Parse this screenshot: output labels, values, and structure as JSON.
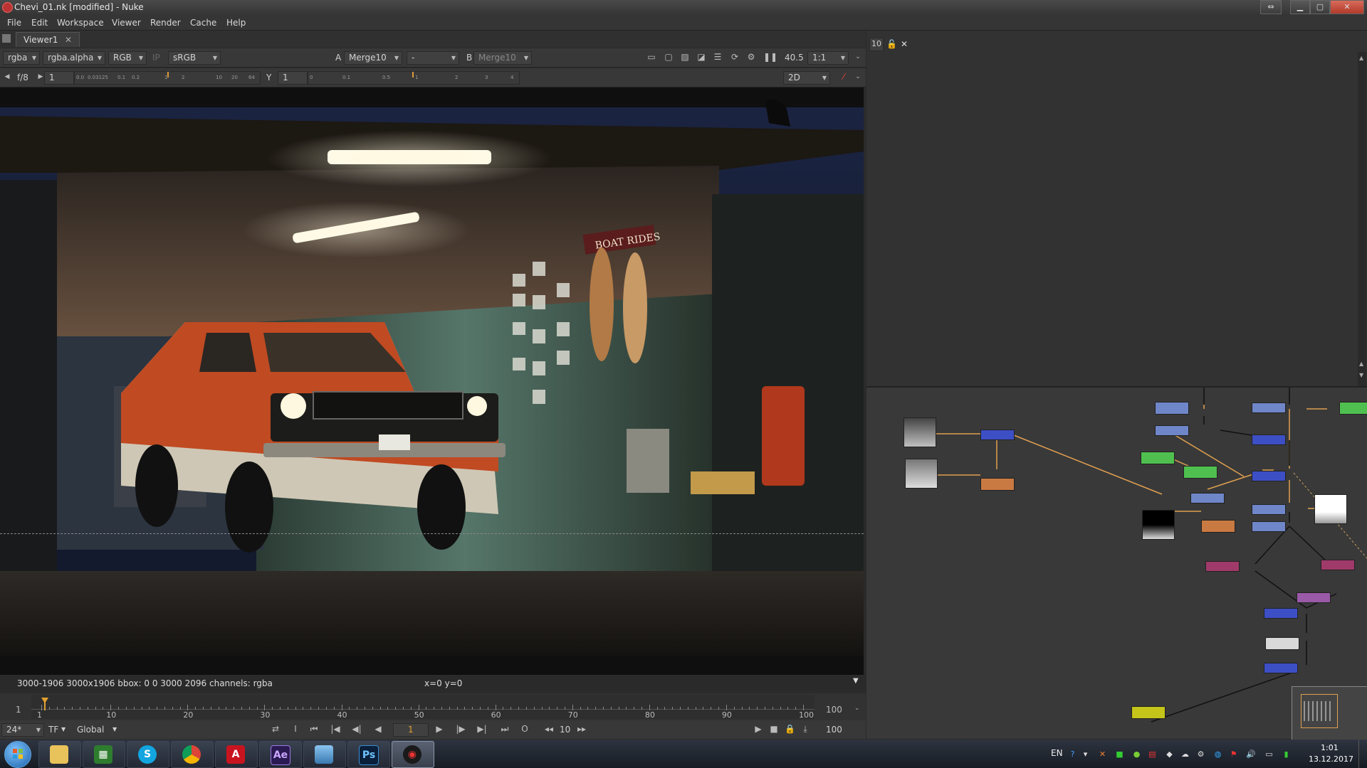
{
  "window": {
    "title": "Chevi_01.nk [modified] - Nuke"
  },
  "menu": [
    "File",
    "Edit",
    "Workspace",
    "Viewer",
    "Render",
    "Cache",
    "Help"
  ],
  "tab": {
    "label": "Viewer1",
    "close": "✕"
  },
  "viewer_toolbar": {
    "channels": "rgba",
    "alpha": "rgba.alpha",
    "colorspace": "RGB",
    "ip": "IP",
    "lut": "sRGB",
    "a_label": "A",
    "a_input": "Merge10",
    "compare_mode": "-",
    "b_label": "B",
    "b_input": "Merge10",
    "zoom": "40.5",
    "proxy": "1:1"
  },
  "viewer_toolbar2": {
    "fstop": "f/8",
    "gain_value": "1",
    "y_label": "Y",
    "gamma_value": "1",
    "view_mode": "2D",
    "gain_ticks": [
      "0.0",
      "0.03125",
      "0.1",
      "0.2",
      "1",
      "2",
      "10",
      "20",
      "64"
    ],
    "gamma_ticks": [
      "0",
      "0.1",
      "0.5",
      "1",
      "2",
      "3",
      "4"
    ]
  },
  "info_bar": {
    "format": "3000-1906 3000x1906  bbox: 0 0 3000 2096 channels: rgba",
    "coords": "x=0 y=0"
  },
  "timeline": {
    "start": "1",
    "end": "100",
    "ticks": [
      "1",
      "10",
      "20",
      "30",
      "40",
      "50",
      "60",
      "70",
      "80",
      "90",
      "100"
    ],
    "current_frame": 1
  },
  "playback": {
    "fps": "24*",
    "tf": "TF",
    "range_mode": "Global",
    "frame": "1",
    "increment": "10",
    "end_frame": "100"
  },
  "props_panel": {
    "max_panels": "10"
  },
  "taskbar": {
    "language": "EN",
    "time": "1:01",
    "date": "13.12.2017",
    "apps": [
      "start",
      "explorer",
      "task-manager",
      "skype",
      "chrome",
      "acrobat",
      "after-effects",
      "photo-viewer",
      "photoshop",
      "nuke"
    ]
  },
  "colors": {
    "node_blue": "#6f86c8",
    "node_dark_blue": "#3d4fc4",
    "node_green": "#4fc04f",
    "node_orange": "#c97a42",
    "node_magenta": "#a03a6a",
    "node_purple": "#9a5aa8",
    "node_yellow": "#c4c41a",
    "edge": "#e0a050"
  }
}
